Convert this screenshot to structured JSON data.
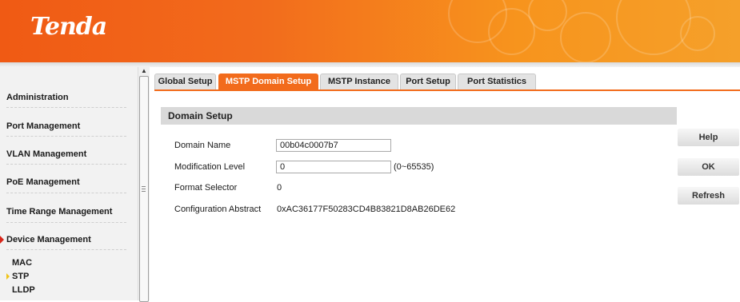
{
  "brand": {
    "logo_text": "Tenda"
  },
  "sidebar": {
    "items": [
      {
        "label": "Administration"
      },
      {
        "label": "Port Management"
      },
      {
        "label": "VLAN Management"
      },
      {
        "label": "PoE Management"
      },
      {
        "label": "Time Range Management"
      },
      {
        "label": "Device Management",
        "expanded": true
      }
    ],
    "subitems": [
      {
        "label": "MAC"
      },
      {
        "label": "STP",
        "selected": true
      },
      {
        "label": "LLDP"
      }
    ]
  },
  "tabs": [
    {
      "label": "Global Setup"
    },
    {
      "label": "MSTP Domain Setup",
      "active": true
    },
    {
      "label": "MSTP Instance"
    },
    {
      "label": "Port Setup"
    },
    {
      "label": "Port Statistics"
    }
  ],
  "panel": {
    "title": "Domain Setup",
    "domain_name": {
      "label": "Domain Name",
      "value": "00b04c0007b7"
    },
    "modification_level": {
      "label": "Modification Level",
      "value": "0",
      "hint": "(0~65535)"
    },
    "format_selector": {
      "label": "Format Selector",
      "value": "0"
    },
    "configuration_abstract": {
      "label": "Configuration Abstract",
      "value": "0xAC36177F50283CD4B83821D8AB26DE62"
    }
  },
  "buttons": {
    "help": "Help",
    "ok": "OK",
    "refresh": "Refresh"
  },
  "colors": {
    "accent": "#f26b1c",
    "header_start": "#f05a14",
    "header_end": "#f5a02a",
    "marker_red": "#d8261a",
    "marker_yellow": "#f0c419"
  }
}
